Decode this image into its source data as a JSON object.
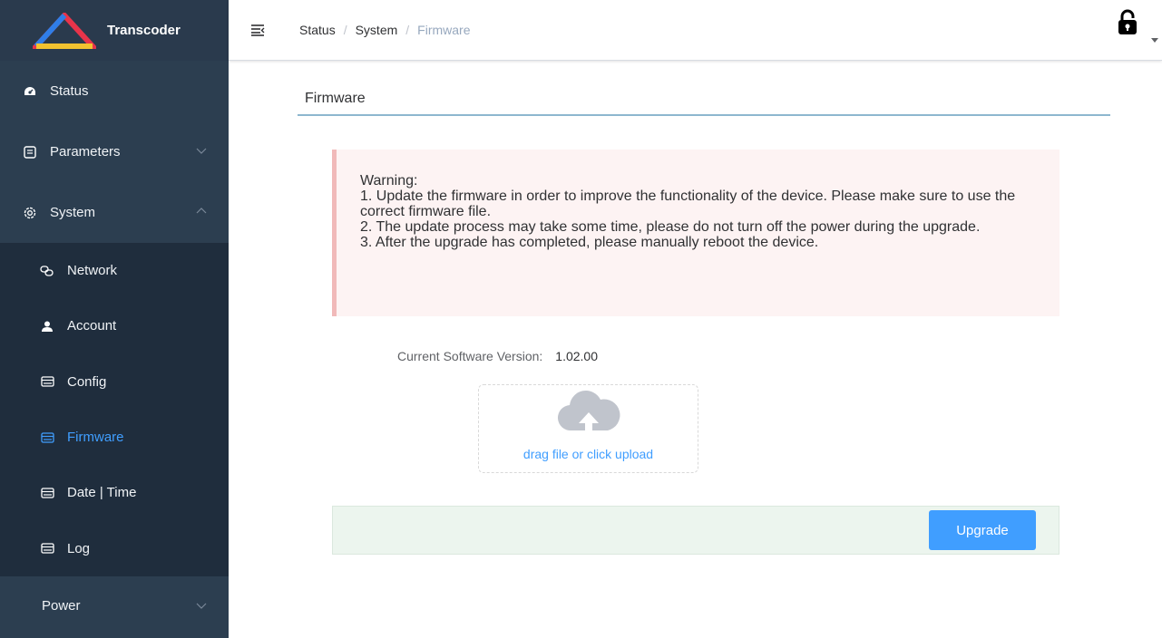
{
  "app": {
    "name": "Transcoder"
  },
  "sidebar": {
    "items": [
      {
        "label": "Status",
        "icon": "dashboard-icon"
      },
      {
        "label": "Parameters",
        "icon": "monitor-icon"
      },
      {
        "label": "System",
        "icon": "gear-icon"
      }
    ],
    "system_sub": [
      {
        "label": "Network",
        "icon": "link-icon"
      },
      {
        "label": "Account",
        "icon": "user-icon"
      },
      {
        "label": "Config",
        "icon": "card-icon"
      },
      {
        "label": "Firmware",
        "icon": "card-icon"
      },
      {
        "label": "Date | Time",
        "icon": "card-icon"
      },
      {
        "label": "Log",
        "icon": "card-icon"
      }
    ],
    "power": {
      "label": "Power"
    }
  },
  "breadcrumb": {
    "items": [
      "Status",
      "System",
      "Firmware"
    ],
    "separator": "/"
  },
  "page": {
    "title": "Firmware",
    "warning": {
      "lines": [
        "Warning:",
        "1. Update the firmware in order to improve the functionality of the device. Please make sure to use the correct firmware file.",
        "2. The update process may take some time, please do not turn off the power during the upgrade.",
        "3. After the upgrade has completed, please manually reboot the device."
      ]
    },
    "version": {
      "label": "Current Software Version:",
      "value": "1.02.00"
    },
    "upload": {
      "text": "drag file or click upload"
    },
    "upgrade_button": "Upgrade"
  },
  "colors": {
    "sidebar_bg": "#2c3e50",
    "submenu_bg": "#1f2d3d",
    "accent": "#409eff",
    "warning_bg": "#fdf3f3",
    "footer_bg": "#ecf5ee"
  }
}
